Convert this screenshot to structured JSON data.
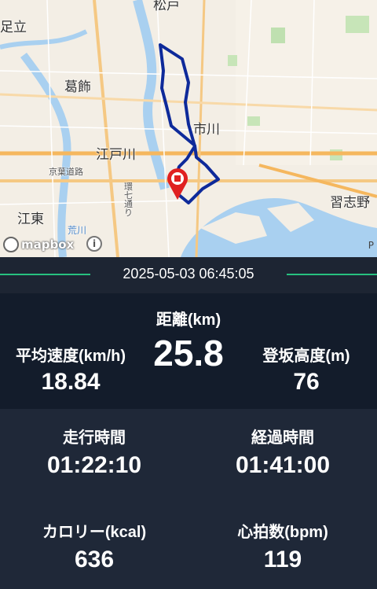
{
  "map": {
    "labels": {
      "matsudo": "松戸",
      "adachi": "足立",
      "katsushika": "葛飾",
      "ichikawa": "市川",
      "edogawa": "江戸川",
      "keiyo_road": "京葉道路",
      "kan7": "環七通り",
      "koto": "江東",
      "arakawa": "荒川",
      "narashino": "習志野",
      "corner": "P"
    },
    "attribution": "mapbox",
    "info_icon": "info-icon",
    "pin_icon": "location-pin-icon",
    "colors": {
      "route": "#0e2a9a",
      "water": "#a9d0f0",
      "pin": "#e02020"
    }
  },
  "session": {
    "datetime": "2025-05-03 06:45:05"
  },
  "stats": {
    "distance": {
      "label": "距離(km)",
      "value": "25.8"
    },
    "avg_speed": {
      "label": "平均速度(km/h)",
      "value": "18.84"
    },
    "elevation": {
      "label": "登坂高度(m)",
      "value": "76"
    },
    "moving_time": {
      "label": "走行時間",
      "value": "01:22:10"
    },
    "elapsed_time": {
      "label": "経過時間",
      "value": "01:41:00"
    },
    "calories": {
      "label": "カロリー(kcal)",
      "value": "636"
    },
    "heart_rate": {
      "label": "心拍数(bpm)",
      "value": "119"
    }
  },
  "theme": {
    "accent": "#27c07f",
    "panel_dark": "#131c2b",
    "panel": "#1f2838"
  }
}
